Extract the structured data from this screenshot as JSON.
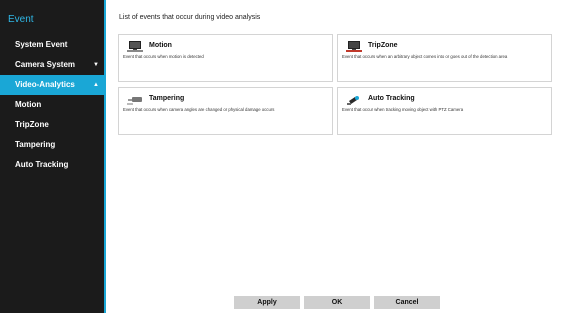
{
  "sidebar": {
    "title": "Event",
    "items": [
      {
        "label": "System Event"
      },
      {
        "label": "Camera System",
        "chevron": "▼"
      },
      {
        "label": "Video-Analytics",
        "chevron": "▲"
      },
      {
        "label": "Motion"
      },
      {
        "label": "TripZone"
      },
      {
        "label": "Tampering"
      },
      {
        "label": "Auto Tracking"
      }
    ]
  },
  "main": {
    "header": "List of events that occur during video analysis",
    "cards": [
      {
        "name": "Motion",
        "desc": "Event that occurs when motion is detected",
        "icon": "monitor-icon"
      },
      {
        "name": "TripZone",
        "desc": "Event that occurs when an arbitrary object comes into or goes out of the detection area",
        "icon": "monitor-icon"
      },
      {
        "name": "Tampering",
        "desc": "Event that occurs when camera angles are changed or physical damage occurs",
        "icon": "camera-icon"
      },
      {
        "name": "Auto Tracking",
        "desc": "Event that occur when tracking moving object with PTZ Camera",
        "icon": "ptz-camera-icon"
      }
    ]
  },
  "buttons": {
    "apply": "Apply",
    "ok": "OK",
    "cancel": "Cancel"
  },
  "colors": {
    "accent": "#1aa7d6",
    "sidebar_bg": "#1b1b1b",
    "button_bg": "#cfcfcf"
  }
}
